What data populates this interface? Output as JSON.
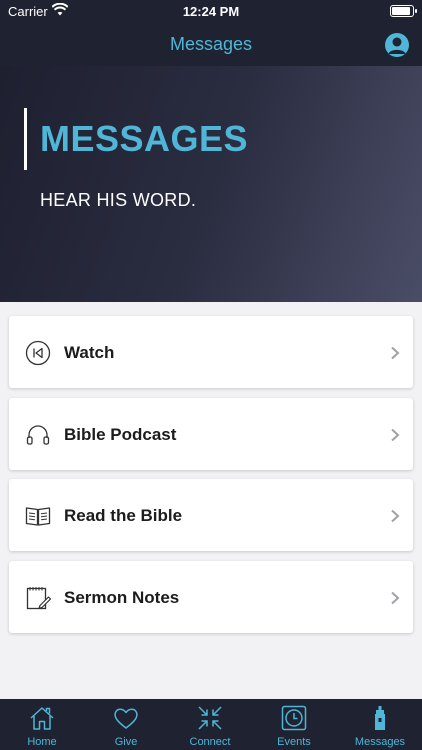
{
  "status_bar": {
    "carrier": "Carrier",
    "time": "12:24 PM"
  },
  "nav": {
    "title": "Messages"
  },
  "hero": {
    "title": "MESSAGES",
    "subtitle": "HEAR HIS WORD."
  },
  "menu": [
    {
      "label": "Watch",
      "icon": "play-back-icon"
    },
    {
      "label": "Bible Podcast",
      "icon": "headphones-icon"
    },
    {
      "label": "Read the Bible",
      "icon": "open-book-icon"
    },
    {
      "label": "Sermon Notes",
      "icon": "notepad-icon"
    }
  ],
  "tabs": [
    {
      "label": "Home",
      "icon": "home-icon"
    },
    {
      "label": "Give",
      "icon": "heart-icon"
    },
    {
      "label": "Connect",
      "icon": "arrows-in-icon"
    },
    {
      "label": "Events",
      "icon": "clock-icon"
    },
    {
      "label": "Messages",
      "icon": "tower-icon",
      "active": true
    }
  ],
  "colors": {
    "accent": "#4fb6d8",
    "bar": "#1f2231",
    "background": "#f2f2f4"
  }
}
